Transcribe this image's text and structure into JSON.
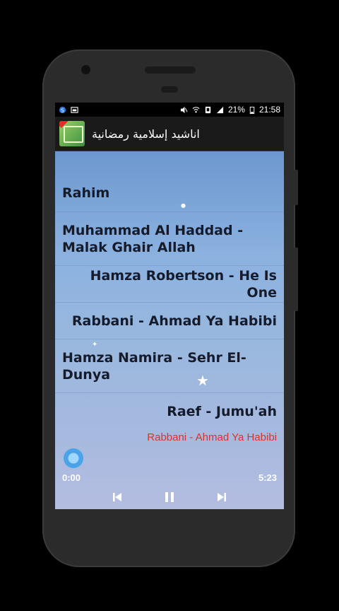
{
  "status_bar": {
    "battery": "21%",
    "time": "21:58"
  },
  "app_bar": {
    "title": "اناشيد إسلامية رمضانية",
    "logo_icon": "app-logo-icon"
  },
  "songs": [
    {
      "title": "Rahim"
    },
    {
      "title": "Muhammad Al Haddad - Malak Ghair Allah"
    },
    {
      "title": "Hamza Robertson - He Is One"
    },
    {
      "title": "Rabbani - Ahmad Ya Habibi"
    },
    {
      "title": "Hamza Namira - Sehr El-Dunya"
    },
    {
      "title": "Raef - Jumu'ah"
    }
  ],
  "player": {
    "now_playing": "Rabbani - Ahmad Ya Habibi",
    "current_time": "0:00",
    "total_time": "5:23",
    "progress": 0.0
  },
  "colors": {
    "now_playing": "#e0302a",
    "seek_knob": "#4aa3e8"
  }
}
